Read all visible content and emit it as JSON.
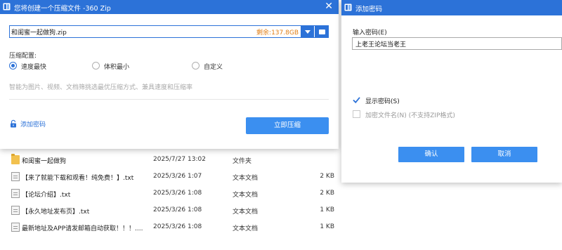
{
  "compress_dialog": {
    "title": "您将创建一个压缩文件 -360 Zip",
    "close_glyph": "✕",
    "archive_name": "和闺蜜一起做狗.zip",
    "space_left": "剩余:137.8GB",
    "section_label": "压缩配置:",
    "options": [
      {
        "label": "速度最快",
        "checked": true
      },
      {
        "label": "体积最小",
        "checked": false
      },
      {
        "label": "自定义",
        "checked": false
      }
    ],
    "hint": "智能为图片、视频、文档筛挑选最优压缩方式、兼具速度和压缩率",
    "add_password_label": "添加密码",
    "compress_button": "立即压缩"
  },
  "password_dialog": {
    "title": "添加密码",
    "password_label": "输入密码(E)",
    "password_value": "上老王论坛当老王",
    "show_password_label": "显示密码(S)",
    "show_password_checked": true,
    "encrypt_names_label": "加密文件名(N) (不支持ZIP格式)",
    "encrypt_names_checked": false,
    "ok_label": "确认",
    "cancel_label": "取消"
  },
  "files": [
    {
      "name": "和闺蜜一起做狗",
      "date": "2025/7/27 13:02",
      "type": "文件夹",
      "size": "",
      "icon": "folder-icon"
    },
    {
      "name": "【来了就能下载和观看！纯免费！】.txt",
      "date": "2025/3/26 1:07",
      "type": "文本文档",
      "size": "2 KB",
      "icon": "text-file-icon"
    },
    {
      "name": "【论坛介绍】.txt",
      "date": "2025/3/26 1:08",
      "type": "文本文档",
      "size": "2 KB",
      "icon": "text-file-icon"
    },
    {
      "name": "【永久地址发布页】.txt",
      "date": "2025/3/26 1:08",
      "type": "文本文档",
      "size": "1 KB",
      "icon": "text-file-icon"
    },
    {
      "name": "最新地址及APP请发邮箱自动获取！！！....",
      "date": "2025/3/26 1:08",
      "type": "文本文档",
      "size": "1 KB",
      "icon": "text-file-icon"
    }
  ],
  "colors": {
    "title_bar": "#2c72d8",
    "primary_button": "#3b8ff0",
    "space_left_text": "#e07d13",
    "link": "#2c72d8"
  }
}
